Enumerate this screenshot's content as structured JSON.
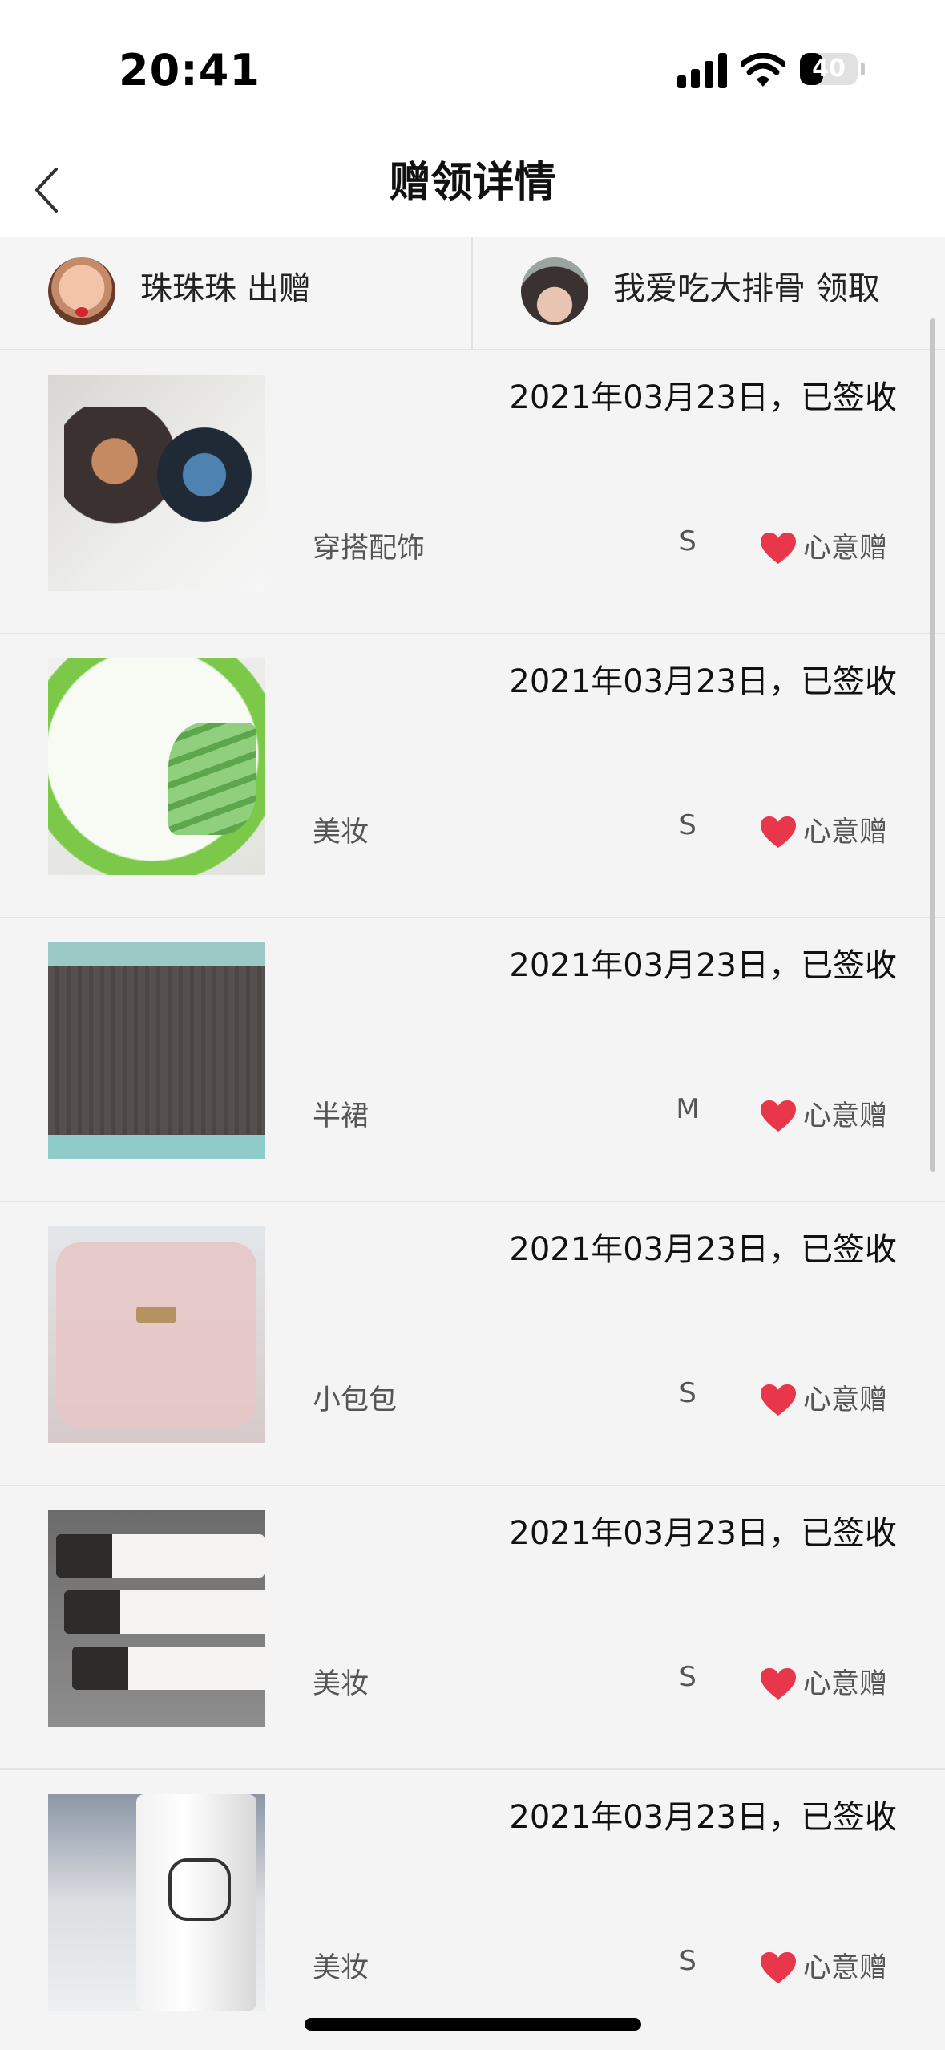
{
  "status_bar": {
    "time": "20:41",
    "battery_level": "40",
    "battery_fraction": 0.4
  },
  "nav": {
    "title": "赠领详情",
    "back_icon": "chevron-left-icon"
  },
  "parties": {
    "giver": {
      "name": "珠珠珠 出赠"
    },
    "receiver": {
      "name": "我爱吃大排骨 领取"
    }
  },
  "items": [
    {
      "date": "2021年03月23日，已签收",
      "category": "穿搭配饰",
      "size": "S",
      "type": "心意赠",
      "thumb": "t-hairclip"
    },
    {
      "date": "2021年03月23日，已签收",
      "category": "美妆",
      "size": "S",
      "type": "心意赠",
      "thumb": "t-aloe"
    },
    {
      "date": "2021年03月23日，已签收",
      "category": "半裙",
      "size": "M",
      "type": "心意赠",
      "thumb": "t-skirt"
    },
    {
      "date": "2021年03月23日，已签收",
      "category": "小包包",
      "size": "S",
      "type": "心意赠",
      "thumb": "t-bag"
    },
    {
      "date": "2021年03月23日，已签收",
      "category": "美妆",
      "size": "S",
      "type": "心意赠",
      "thumb": "t-tubes"
    },
    {
      "date": "2021年03月23日，已签收",
      "category": "美妆",
      "size": "S",
      "type": "心意赠",
      "thumb": "t-bottle"
    }
  ],
  "colors": {
    "heart": "#e8364a",
    "background": "#f4f4f4",
    "nav_background": "#ffffff"
  }
}
